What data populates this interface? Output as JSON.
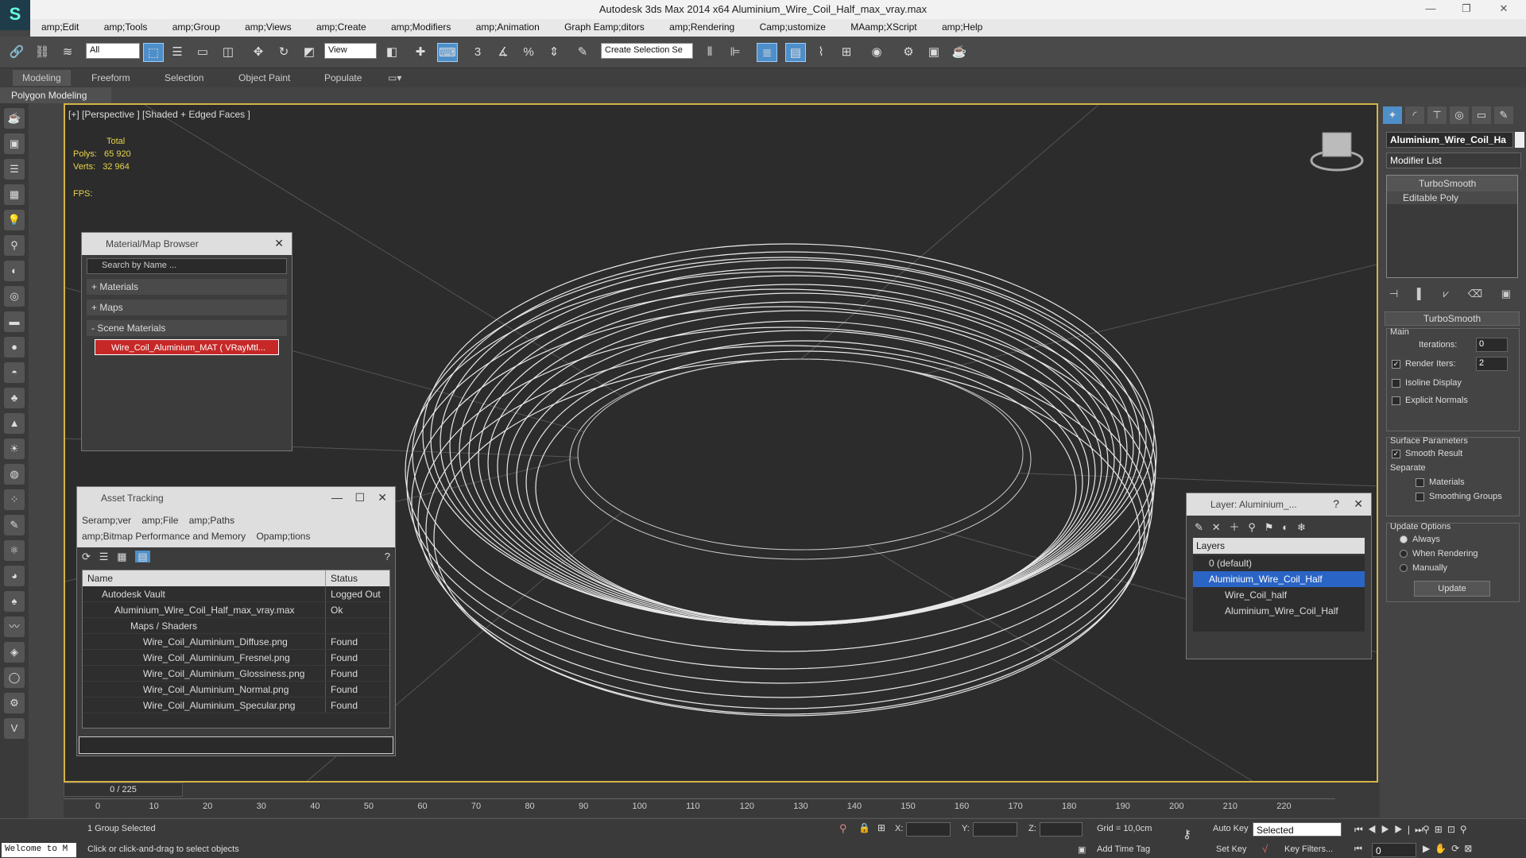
{
  "app": {
    "title": "Autodesk 3ds Max  2014 x64     Aluminium_Wire_Coil_Half_max_vray.max",
    "min_glyph": "—",
    "max_glyph": "❐",
    "close_glyph": "✕"
  },
  "menu": [
    "amp;Edit",
    "amp;Tools",
    "amp;Group",
    "amp;Views",
    "amp;Create",
    "amp;Modifiers",
    "amp;Animation",
    "Graph Eamp;ditors",
    "amp;Rendering",
    "Camp;ustomize",
    "MAamp;XScript",
    "amp;Help"
  ],
  "toolbar": {
    "selection_filter": "All",
    "ref_coord": "View",
    "named_selection": "Create Selection Se"
  },
  "ribbon": {
    "tabs": [
      "Modeling",
      "Freeform",
      "Selection",
      "Object Paint",
      "Populate"
    ],
    "subtitle": "Polygon Modeling"
  },
  "viewport": {
    "label": "[+] [Perspective ] [Shaded + Edged Faces ]",
    "stats": {
      "total_label": "Total",
      "polys_label": "Polys:",
      "polys_value": "65 920",
      "verts_label": "Verts:",
      "verts_value": "32 964",
      "fps_label": "FPS:"
    }
  },
  "material_browser": {
    "title": "Material/Map Browser",
    "search_placeholder": "Search by Name ...",
    "groups": [
      "+ Materials",
      "+ Maps",
      "- Scene Materials"
    ],
    "scene_material": "Wire_Coil_Aluminium_MAT  ( VRayMtl..."
  },
  "asset_tracking": {
    "title": "Asset Tracking",
    "menu": [
      "Seramp;ver",
      "amp;File",
      "amp;Paths",
      "amp;Bitmap Performance and Memory",
      "Opamp;tions"
    ],
    "columns": [
      "Name",
      "Status"
    ],
    "rows": [
      {
        "name": "Autodesk Vault",
        "status": "Logged Out"
      },
      {
        "name": "Aluminium_Wire_Coil_Half_max_vray.max",
        "status": "Ok"
      },
      {
        "name": "Maps / Shaders",
        "status": ""
      },
      {
        "name": "Wire_Coil_Aluminium_Diffuse.png",
        "status": "Found"
      },
      {
        "name": "Wire_Coil_Aluminium_Fresnel.png",
        "status": "Found"
      },
      {
        "name": "Wire_Coil_Aluminium_Glossiness.png",
        "status": "Found"
      },
      {
        "name": "Wire_Coil_Aluminium_Normal.png",
        "status": "Found"
      },
      {
        "name": "Wire_Coil_Aluminium_Specular.png",
        "status": "Found"
      }
    ]
  },
  "layer_dialog": {
    "title": "Layer: Aluminium_...",
    "help": "?",
    "header": "Layers",
    "items": [
      "0 (default)",
      "Aluminium_Wire_Coil_Half",
      "Wire_Coil_half",
      "Aluminium_Wire_Coil_Half"
    ]
  },
  "command_panel": {
    "object_name": "Aluminium_Wire_Coil_Ha",
    "modifier_list": "Modifier List",
    "stack": [
      "TurboSmooth",
      "Editable Poly"
    ],
    "rollout_title": "TurboSmooth",
    "main_label": "Main",
    "iterations_label": "Iterations:",
    "iterations_value": "0",
    "render_iters_label": "Render Iters:",
    "render_iters_value": "2",
    "isoline": "Isoline Display",
    "explicit_normals": "Explicit Normals",
    "surface_params": "Surface Parameters",
    "smooth_result": "Smooth Result",
    "separate": "Separate",
    "materials": "Materials",
    "smoothing_groups": "Smoothing Groups",
    "update_options": "Update Options",
    "always": "Always",
    "when_rendering": "When Rendering",
    "manually": "Manually",
    "update_button": "Update"
  },
  "timeline": {
    "frame_counter": "0 / 225",
    "ticks": [
      "0",
      "10",
      "20",
      "30",
      "40",
      "50",
      "60",
      "70",
      "80",
      "90",
      "100",
      "110",
      "120",
      "130",
      "140",
      "150",
      "160",
      "170",
      "180",
      "190",
      "200",
      "210",
      "220"
    ]
  },
  "status": {
    "welcome": "Welcome to M",
    "selected": "1 Group Selected",
    "prompt": "Click or click-and-drag to select objects",
    "x_label": "X:",
    "y_label": "Y:",
    "z_label": "Z:",
    "grid": "Grid = 10,0cm",
    "add_time_tag": "Add Time Tag",
    "auto_key": "Auto Key",
    "set_key": "Set Key",
    "key_mode": "Selected",
    "key_filters": "Key Filters...",
    "frame_value": "0"
  }
}
